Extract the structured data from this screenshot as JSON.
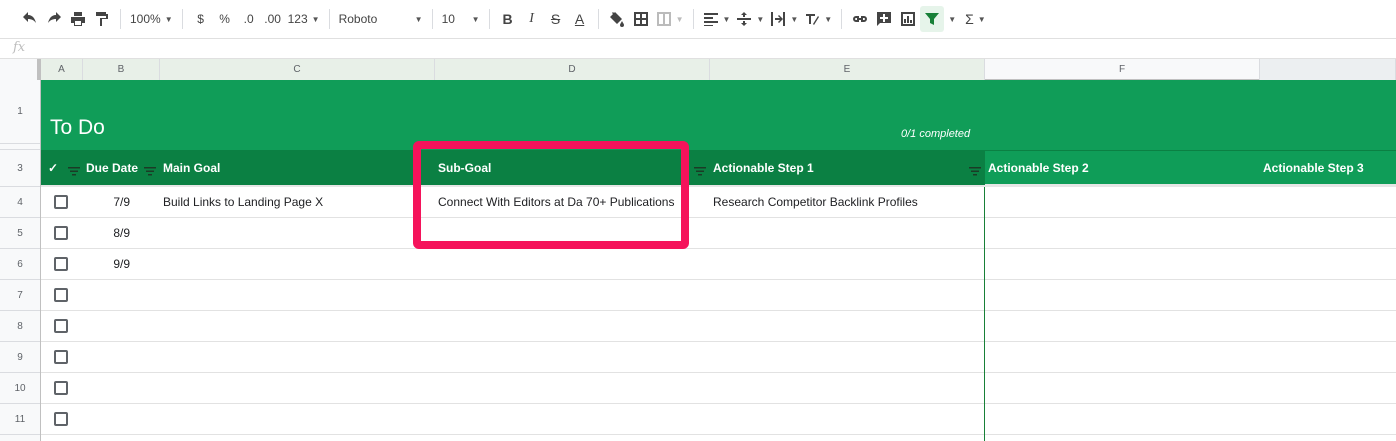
{
  "toolbar": {
    "zoom": "100%",
    "currency": "$",
    "percent": "%",
    "decrease_decimal": ".0",
    "increase_decimal": ".00",
    "number_format": "123",
    "font": "Roboto",
    "font_size": "10",
    "bold": "B",
    "italic": "I",
    "strike": "S",
    "text_color": "A",
    "sum": "Σ"
  },
  "formula_bar": {
    "fx": "fx"
  },
  "columns": [
    "A",
    "B",
    "C",
    "D",
    "E",
    "F"
  ],
  "rows": [
    "1",
    "2",
    "3",
    "4",
    "5",
    "6",
    "7",
    "8",
    "9",
    "10",
    "11"
  ],
  "sheet": {
    "title": "To Do",
    "completed": "0/1 completed",
    "headers": {
      "check": "✓",
      "due_date": "Due Date",
      "main_goal": "Main Goal",
      "sub_goal": "Sub-Goal",
      "step1": "Actionable Step 1",
      "step2": "Actionable Step 2",
      "step3": "Actionable Step 3"
    },
    "tasks": [
      {
        "due": "7/9",
        "main_goal": "Build Links to Landing Page X",
        "sub_goal": "Connect With Editors at Da 70+ Publications",
        "step1": "Research Competitor Backlink Profiles"
      },
      {
        "due": "8/9",
        "main_goal": "",
        "sub_goal": "",
        "step1": ""
      },
      {
        "due": "9/9",
        "main_goal": "",
        "sub_goal": "",
        "step1": ""
      },
      {
        "due": "",
        "main_goal": "",
        "sub_goal": "",
        "step1": ""
      },
      {
        "due": "",
        "main_goal": "",
        "sub_goal": "",
        "step1": ""
      },
      {
        "due": "",
        "main_goal": "",
        "sub_goal": "",
        "step1": ""
      },
      {
        "due": "",
        "main_goal": "",
        "sub_goal": "",
        "step1": ""
      },
      {
        "due": "",
        "main_goal": "",
        "sub_goal": "",
        "step1": ""
      }
    ]
  },
  "colors": {
    "banner": "#109d58",
    "header_dark": "#0b8043",
    "highlight": "#f5135b"
  }
}
